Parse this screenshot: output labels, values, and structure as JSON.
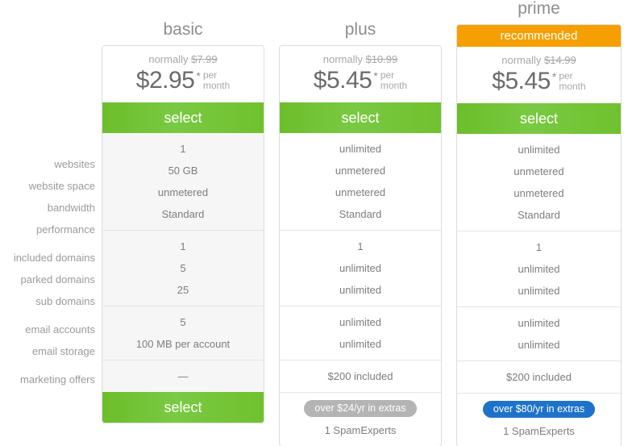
{
  "feature_labels": [
    "websites",
    "website space",
    "bandwidth",
    "performance",
    "included domains",
    "parked domains",
    "sub domains",
    "email accounts",
    "email storage",
    "marketing offers"
  ],
  "select_label": "select",
  "price_prefix": "normally",
  "asterisk": "*",
  "per_month_line1": "per",
  "per_month_line2": "month",
  "colors": {
    "select_green": "#7ac943",
    "recommended_orange": "#f5a000",
    "badge_grey": "#b4b4b4",
    "badge_blue": "#1e73c8",
    "card_grey": "#f6f6f6",
    "card_white": "#ffffff",
    "label_text": "#9b9b9b",
    "value_text": "#7d7d7d"
  },
  "plans": [
    {
      "name": "basic",
      "recommended_label": null,
      "normal_price": "$7.99",
      "price": "$2.95",
      "websites": "1",
      "website_space": "50 GB",
      "bandwidth": "unmetered",
      "performance": "Standard",
      "included_domains": "1",
      "parked_domains": "5",
      "sub_domains": "25",
      "email_accounts": "5",
      "email_storage": "100 MB per account",
      "marketing_offers": "—",
      "extras_badge": null,
      "spam_experts": null
    },
    {
      "name": "plus",
      "recommended_label": null,
      "normal_price": "$10.99",
      "price": "$5.45",
      "websites": "unlimited",
      "website_space": "unmetered",
      "bandwidth": "unmetered",
      "performance": "Standard",
      "included_domains": "1",
      "parked_domains": "unlimited",
      "sub_domains": "unlimited",
      "email_accounts": "unlimited",
      "email_storage": "unlimited",
      "marketing_offers": "$200 included",
      "extras_badge": "over $24/yr in extras",
      "spam_experts": "1 SpamExperts"
    },
    {
      "name": "prime",
      "recommended_label": "recommended",
      "normal_price": "$14.99",
      "price": "$5.45",
      "websites": "unlimited",
      "website_space": "unmetered",
      "bandwidth": "unmetered",
      "performance": "Standard",
      "included_domains": "1",
      "parked_domains": "unlimited",
      "sub_domains": "unlimited",
      "email_accounts": "unlimited",
      "email_storage": "unlimited",
      "marketing_offers": "$200 included",
      "extras_badge": "over $80/yr in extras",
      "spam_experts": "1 SpamExperts"
    }
  ]
}
